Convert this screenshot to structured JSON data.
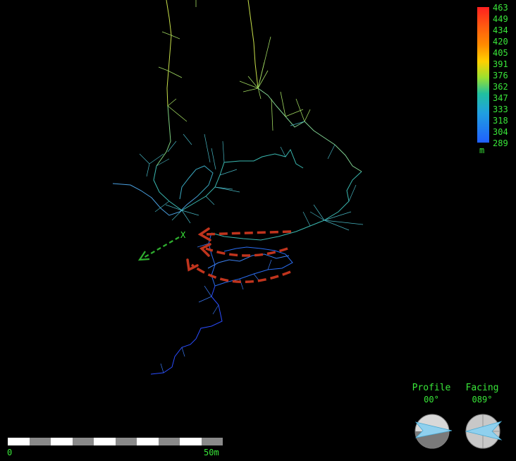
{
  "legend": {
    "labels": [
      "463",
      "449",
      "434",
      "420",
      "405",
      "391",
      "376",
      "362",
      "347",
      "333",
      "318",
      "304",
      "289"
    ],
    "unit": "m"
  },
  "scale": {
    "start": "0",
    "end": "50m"
  },
  "profile": {
    "title": "Profile",
    "value": "00°"
  },
  "facing": {
    "title": "Facing",
    "value": "089°"
  },
  "marker": {
    "label": "X"
  },
  "colors": {
    "background": "#000000",
    "text": "#39e639",
    "annotation_red": "#c0341d",
    "annotation_green": "#2fae2f",
    "survey_high": "#c8e04a",
    "survey_mid": "#3ab8b0",
    "survey_low": "#2a4cff"
  }
}
